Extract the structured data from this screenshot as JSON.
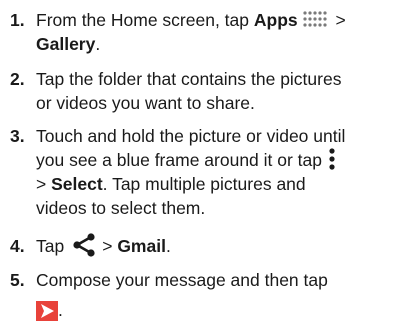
{
  "steps": [
    {
      "num": "1.",
      "line1_a": "From the Home screen, tap ",
      "line1_bold": "Apps",
      "line1_sep": " >",
      "line2_bold": "Gallery",
      "line2_end": "."
    },
    {
      "num": "2.",
      "line1": "Tap the folder that contains the pictures",
      "line2": "or videos you want to share."
    },
    {
      "num": "3.",
      "line1": "Touch and hold the picture or video until",
      "line2": "you see a blue frame around it or tap",
      "line3_a": "> ",
      "line3_bold": "Select",
      "line3_b": ". Tap multiple pictures and",
      "line4": "videos to select them."
    },
    {
      "num": "4.",
      "line1_a": "Tap",
      "line1_b": "> ",
      "line1_bold": "Gmail",
      "line1_end": "."
    },
    {
      "num": "5.",
      "line1": "Compose your message and then tap",
      "line2_end": "."
    }
  ],
  "icons": {
    "apps": "apps-grid-icon",
    "menu": "more-vertical-icon",
    "share": "share-icon",
    "send": "send-icon"
  },
  "colors": {
    "apps_icon": "#7a7a7a",
    "send_bg": "#e8423a",
    "text": "#1a1a1a"
  }
}
